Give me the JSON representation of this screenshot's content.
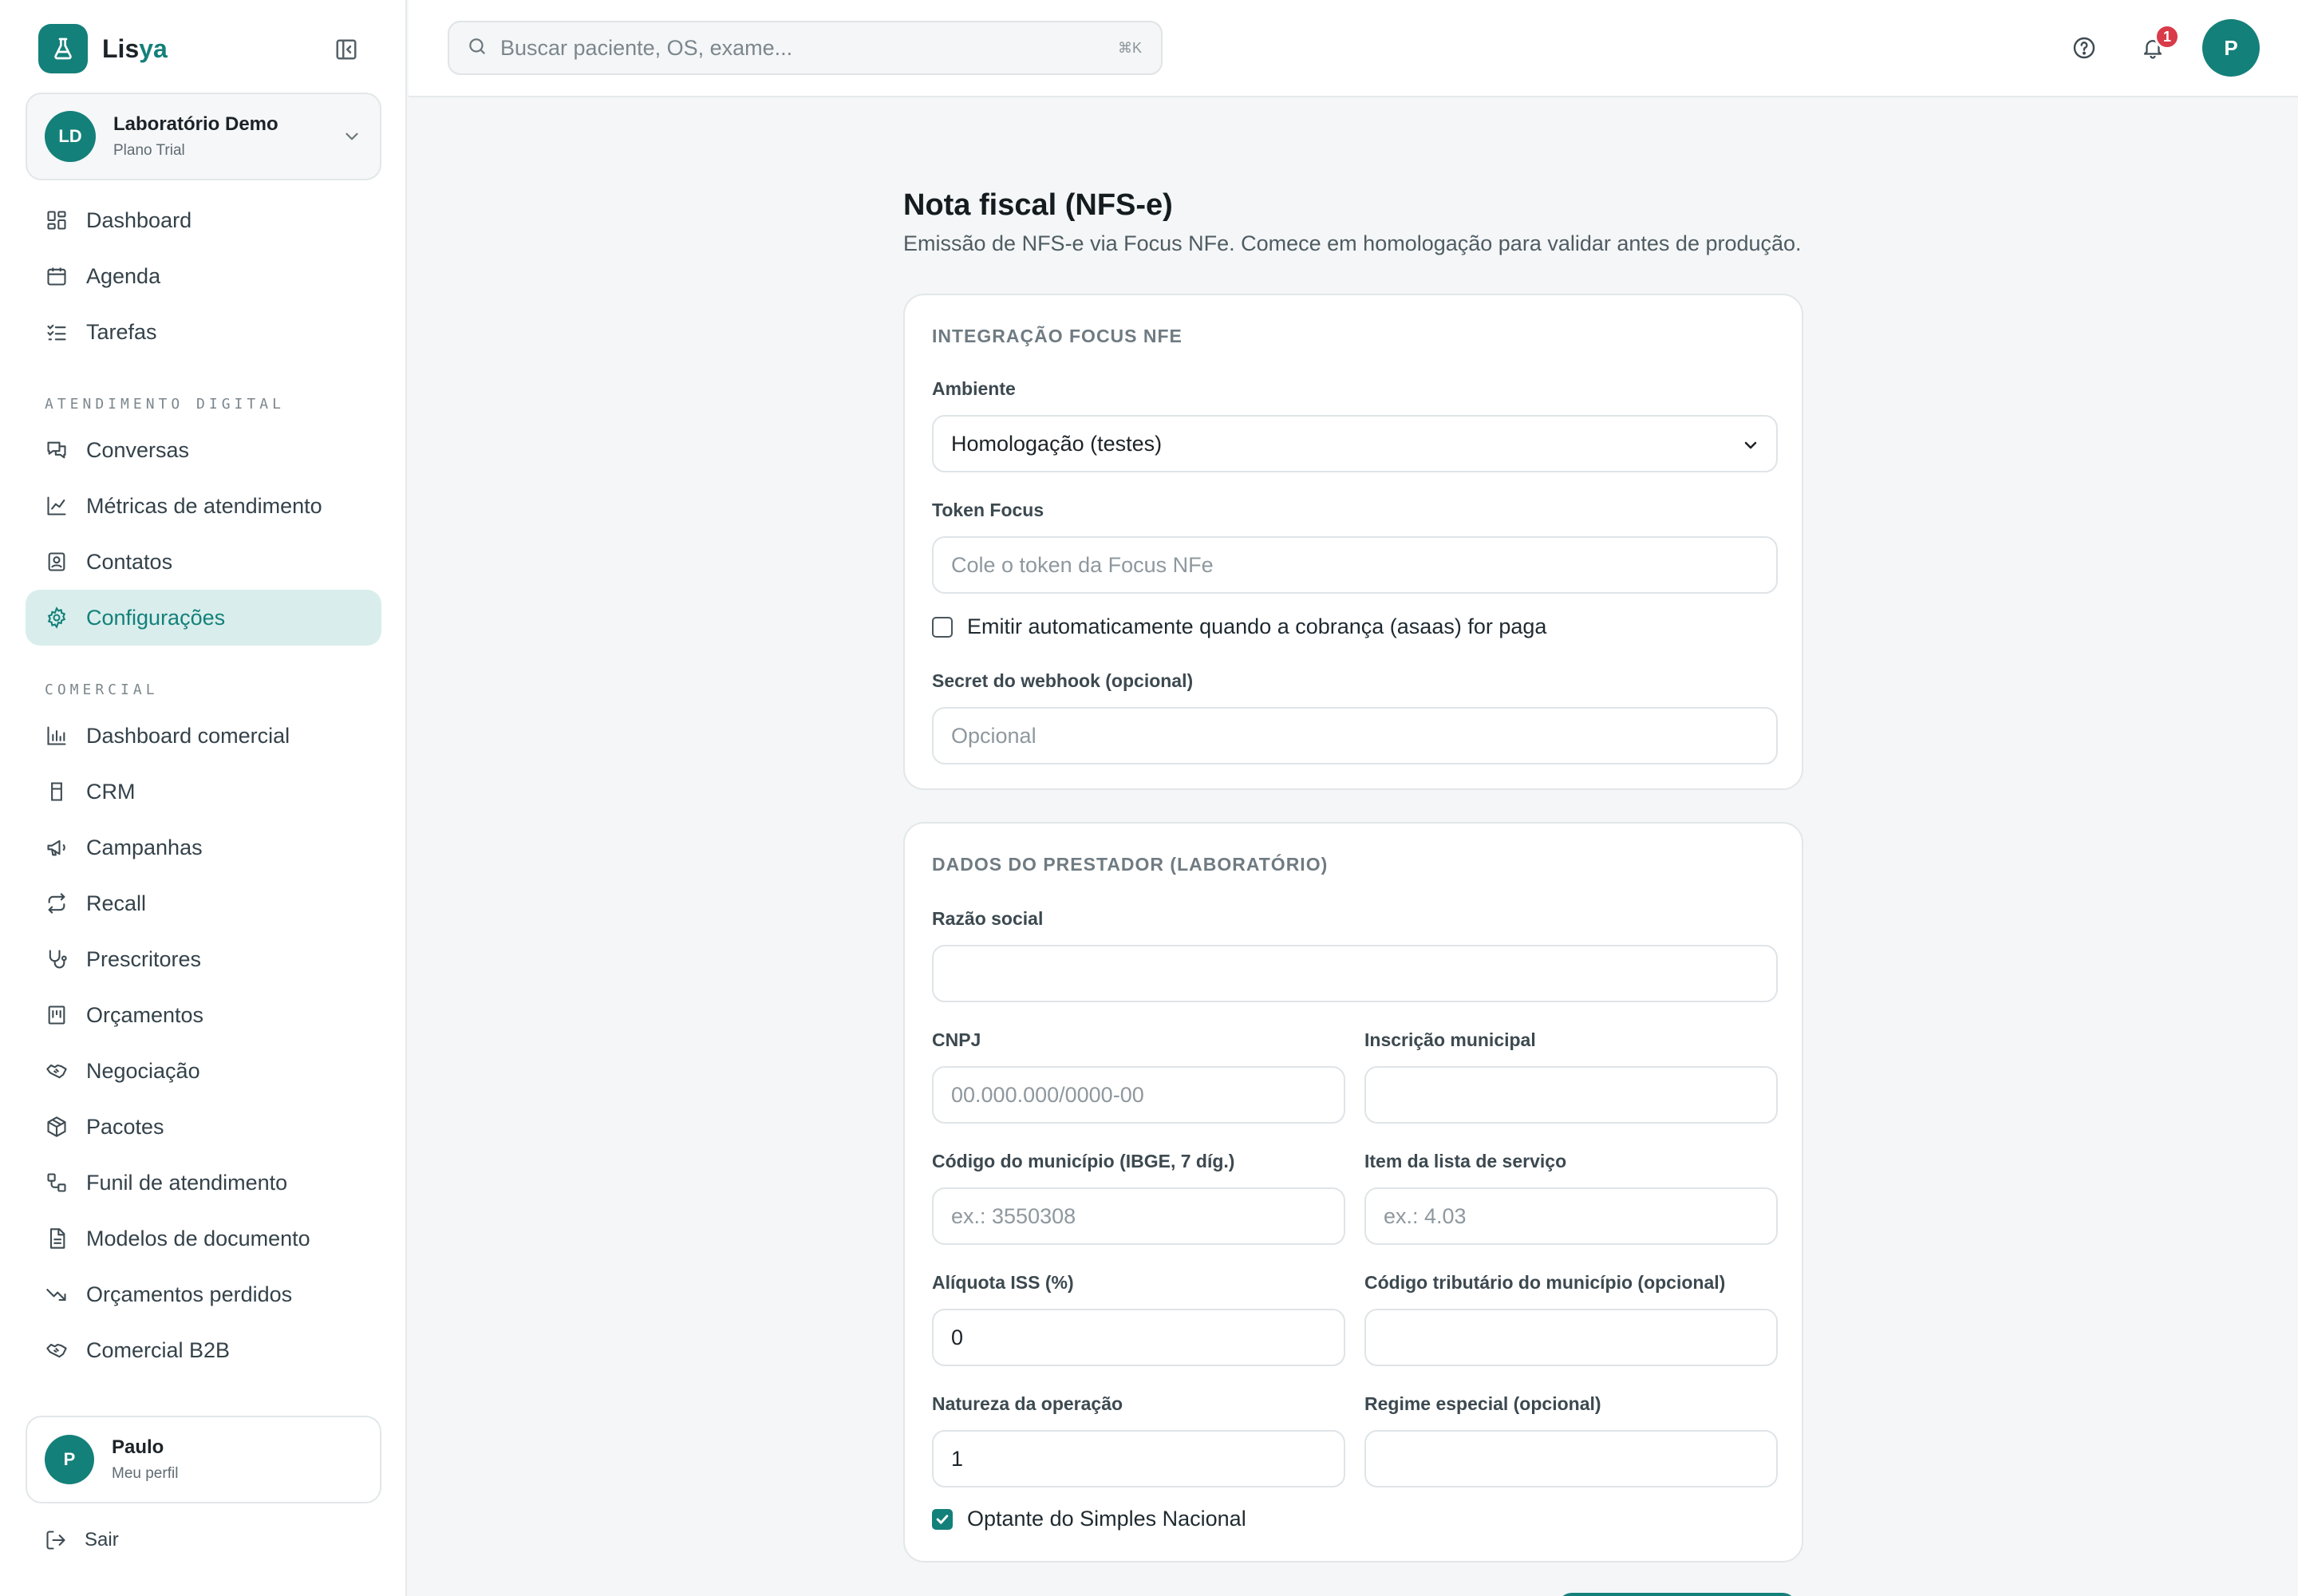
{
  "brand": {
    "name_prefix": "Lis",
    "name_suffix": "ya"
  },
  "org": {
    "initials": "LD",
    "name": "Laboratório Demo",
    "plan": "Plano Trial"
  },
  "nav": {
    "main": [
      {
        "label": "Dashboard",
        "icon": "dashboard-icon"
      },
      {
        "label": "Agenda",
        "icon": "calendar-icon"
      },
      {
        "label": "Tarefas",
        "icon": "checklist-icon"
      }
    ],
    "section_atendimento": "ATENDIMENTO DIGITAL",
    "atendimento": [
      {
        "label": "Conversas",
        "icon": "chat-icon"
      },
      {
        "label": "Métricas de atendimento",
        "icon": "line-chart-icon"
      },
      {
        "label": "Contatos",
        "icon": "contact-icon"
      },
      {
        "label": "Configurações",
        "icon": "gear-icon",
        "active": true
      }
    ],
    "section_comercial": "COMERCIAL",
    "comercial": [
      {
        "label": "Dashboard comercial",
        "icon": "bar-chart-icon"
      },
      {
        "label": "CRM",
        "icon": "crm-icon"
      },
      {
        "label": "Campanhas",
        "icon": "megaphone-icon"
      },
      {
        "label": "Recall",
        "icon": "repeat-icon"
      },
      {
        "label": "Prescritores",
        "icon": "stethoscope-icon"
      },
      {
        "label": "Orçamentos",
        "icon": "quote-icon"
      },
      {
        "label": "Negociação",
        "icon": "handshake-icon"
      },
      {
        "label": "Pacotes",
        "icon": "package-icon"
      },
      {
        "label": "Funil de atendimento",
        "icon": "funnel-icon"
      },
      {
        "label": "Modelos de documento",
        "icon": "document-icon"
      },
      {
        "label": "Orçamentos perdidos",
        "icon": "trending-down-icon"
      },
      {
        "label": "Comercial B2B",
        "icon": "handshake-icon"
      }
    ]
  },
  "profile": {
    "initial": "P",
    "name": "Paulo",
    "sub": "Meu perfil"
  },
  "logout_label": "Sair",
  "topbar": {
    "search_placeholder": "Buscar paciente, OS, exame...",
    "search_shortcut": "⌘K",
    "notifications_count": "1",
    "avatar_initial": "P"
  },
  "page": {
    "title": "Nota fiscal (NFS-e)",
    "subtitle": "Emissão de NFS-e via Focus NFe. Comece em homologação para validar antes de produção."
  },
  "integration": {
    "heading": "INTEGRAÇÃO FOCUS NFE",
    "ambiente_label": "Ambiente",
    "ambiente_value": "Homologação (testes)",
    "token_label": "Token Focus",
    "token_placeholder": "Cole o token da Focus NFe",
    "auto_emit_label": "Emitir automaticamente quando a cobrança (asaas) for paga",
    "auto_emit_checked": false,
    "webhook_label": "Secret do webhook (opcional)",
    "webhook_placeholder": "Opcional"
  },
  "provider": {
    "heading": "DADOS DO PRESTADOR (LABORATÓRIO)",
    "razao_label": "Razão social",
    "razao_value": "",
    "cnpj_label": "CNPJ",
    "cnpj_placeholder": "00.000.000/0000-00",
    "inscricao_label": "Inscrição municipal",
    "inscricao_value": "",
    "municipio_label": "Código do município (IBGE, 7 díg.)",
    "municipio_placeholder": "ex.: 3550308",
    "item_label": "Item da lista de serviço",
    "item_placeholder": "ex.: 4.03",
    "aliquota_label": "Alíquota ISS (%)",
    "aliquota_value": "0",
    "codigo_trib_label": "Código tributário do município (opcional)",
    "codigo_trib_value": "",
    "natureza_label": "Natureza da operação",
    "natureza_value": "1",
    "regime_label": "Regime especial (opcional)",
    "regime_value": "",
    "simples_label": "Optante do Simples Nacional",
    "simples_checked": true
  },
  "colors": {
    "accent": "#14807a",
    "accent_light": "#d9eeec",
    "badge": "#d93b48"
  }
}
